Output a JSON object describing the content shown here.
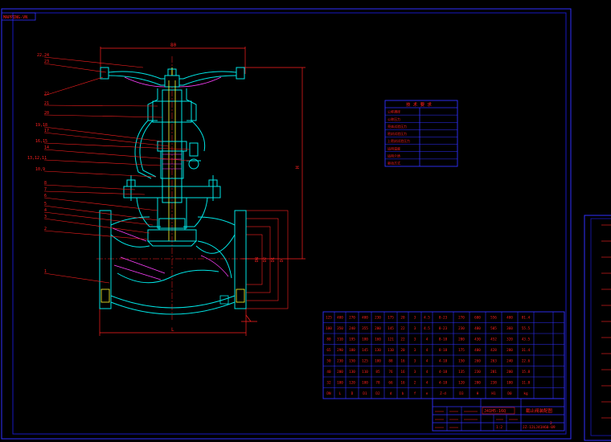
{
  "sheet": {
    "corner_tag": "MAPPING-VN",
    "accent_red": "#ff2020",
    "accent_cyan": "#00e5e5",
    "accent_blue": "#3030ff",
    "accent_magenta": "#ff40ff",
    "accent_yellow": "#ffff30"
  },
  "drawing": {
    "top_dim": "80",
    "height_dim": "H",
    "bottom_dim": "L",
    "body_dim_labels": [
      "D",
      "D1",
      "D2",
      "DN"
    ],
    "leaders": [
      "22,24",
      "23",
      "22",
      "21",
      "20",
      "19,18",
      "17",
      "16,15",
      "14",
      "13,12,11",
      "10,9",
      "8",
      "7",
      "6",
      "5",
      "4",
      "3",
      "2",
      "1"
    ]
  },
  "tech_req": {
    "title": "技 术 要 求",
    "rows": [
      "公称通径",
      "公称压力",
      "壳体试验压力",
      "密封试验压力",
      "上密封试验压力",
      "适用温度",
      "适用介质",
      "驱动方式"
    ]
  },
  "dim_table": {
    "rows": [
      [
        "125",
        "400",
        "270",
        "400",
        "230",
        "175",
        "20",
        "3",
        "4.5",
        "8-23",
        "270",
        "600",
        "556",
        "400",
        "81.4"
      ],
      [
        "100",
        "350",
        "240",
        "355",
        "200",
        "145",
        "22",
        "3",
        "4.5",
        "8-23",
        "230",
        "480",
        "505",
        "360",
        "55.5"
      ],
      [
        "80",
        "310",
        "195",
        "180",
        "160",
        "121",
        "22",
        "3",
        "4",
        "8-18",
        "200",
        "430",
        "452",
        "320",
        "43.5"
      ],
      [
        "65",
        "290",
        "180",
        "145",
        "130",
        "110",
        "20",
        "3",
        "4",
        "8-18",
        "175",
        "400",
        "428",
        "280",
        "31.4"
      ],
      [
        "50",
        "230",
        "150",
        "125",
        "100",
        "88",
        "16",
        "3",
        "4",
        "4-18",
        "150",
        "260",
        "263",
        "240",
        "22.6"
      ],
      [
        "40",
        "200",
        "130",
        "110",
        "85",
        "76",
        "16",
        "3",
        "4",
        "4-18",
        "135",
        "230",
        "281",
        "200",
        "15.8"
      ],
      [
        "32",
        "180",
        "120",
        "100",
        "78",
        "66",
        "16",
        "2",
        "4",
        "4-18",
        "120",
        "200",
        "238",
        "180",
        "11.8"
      ],
      [
        "DN",
        "L",
        "D",
        "D1",
        "D2",
        "d",
        "b",
        "f",
        "e",
        "Z-d",
        "D3",
        "H",
        "H1",
        "D0",
        "kg"
      ]
    ]
  },
  "title_block": {
    "model": "J41H5-16Q",
    "name": "截止阀装配图",
    "drawing_no": "JZ-12LJ41H60-09",
    "scale": "1:2",
    "sheet_no": "2"
  }
}
